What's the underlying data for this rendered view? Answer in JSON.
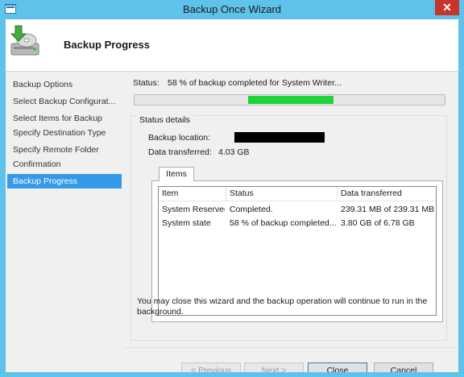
{
  "window": {
    "title": "Backup Once Wizard",
    "close_glyph": "✕"
  },
  "header": {
    "title": "Backup Progress",
    "icon": "backup-drive-icon"
  },
  "nav": {
    "items": [
      {
        "label": "Backup Options",
        "active": false
      },
      {
        "label": "Select Backup Configurat...",
        "active": false
      },
      {
        "label": "Select Items for Backup",
        "active": false
      },
      {
        "label": "Specify Destination Type",
        "active": false
      },
      {
        "label": "Specify Remote Folder",
        "active": false
      },
      {
        "label": "Confirmation",
        "active": false
      },
      {
        "label": "Backup Progress",
        "active": true
      }
    ]
  },
  "status": {
    "label": "Status:",
    "text": "58 % of backup completed for System Writer...",
    "progress_fill_start": 0.365,
    "progress_fill_end": 0.64,
    "progress_color": "#1fd33a"
  },
  "details": {
    "group_title": "Status details",
    "backup_location_label": "Backup location:",
    "data_transferred_label": "Data transferred:",
    "data_transferred_value": "4.03 GB",
    "tab_label": "Items",
    "columns": [
      "Item",
      "Status",
      "Data transferred"
    ],
    "rows": [
      [
        "System Reserved",
        "Completed.",
        "239.31 MB of 239.31 MB"
      ],
      [
        "System state",
        "58 % of backup completed...",
        "3.80 GB of 6.78 GB"
      ]
    ]
  },
  "note": "You may close this wizard and the backup operation will continue to run in the background.",
  "buttons": {
    "previous": "< Previous",
    "next": "Next >",
    "close": "Close",
    "cancel": "Cancel"
  },
  "colors": {
    "titlebar": "#5ec2ea",
    "nav_active": "#3399e8",
    "close_button": "#c7342b"
  }
}
